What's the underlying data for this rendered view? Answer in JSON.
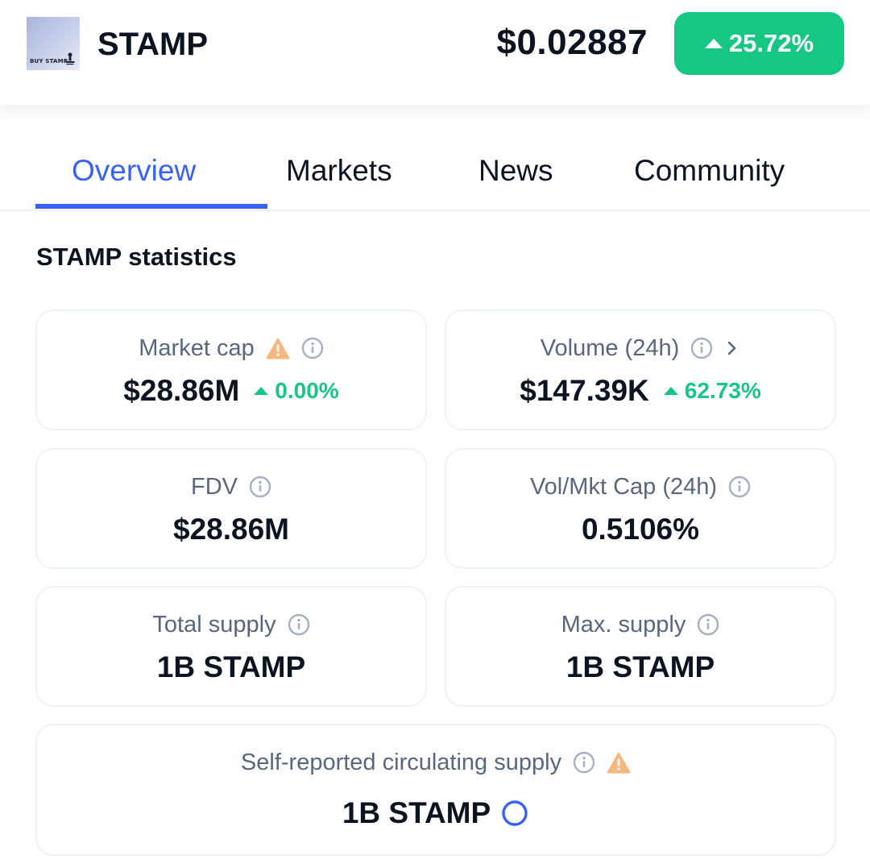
{
  "header": {
    "coin_name": "STAMP",
    "logo_text": "BUY STAMP",
    "price": "$0.02887",
    "change_24h": "25.72%"
  },
  "tabs": [
    {
      "label": "Overview",
      "active": true
    },
    {
      "label": "Markets",
      "active": false
    },
    {
      "label": "News",
      "active": false
    },
    {
      "label": "Community",
      "active": false
    }
  ],
  "stats": {
    "title": "STAMP statistics",
    "market_cap": {
      "label": "Market cap",
      "value": "$28.86M",
      "change": "0.00%"
    },
    "volume": {
      "label": "Volume (24h)",
      "value": "$147.39K",
      "change": "62.73%"
    },
    "fdv": {
      "label": "FDV",
      "value": "$28.86M"
    },
    "vol_mkt_cap": {
      "label": "Vol/Mkt Cap (24h)",
      "value": "0.5106%"
    },
    "total_supply": {
      "label": "Total supply",
      "value": "1B STAMP"
    },
    "max_supply": {
      "label": "Max. supply",
      "value": "1B STAMP"
    },
    "circulating_supply": {
      "label": "Self-reported circulating supply",
      "value": "1B STAMP"
    }
  },
  "colors": {
    "accent_blue": "#3861fb",
    "positive_green": "#16c784",
    "warning_orange": "#f6b87e",
    "label_gray": "#58667e",
    "card_border": "#eff2f5"
  },
  "icons": {
    "info": "info-circle-icon",
    "warning": "warning-triangle-icon",
    "chevron": "chevron-right-icon",
    "progress": "circle-progress-icon"
  }
}
